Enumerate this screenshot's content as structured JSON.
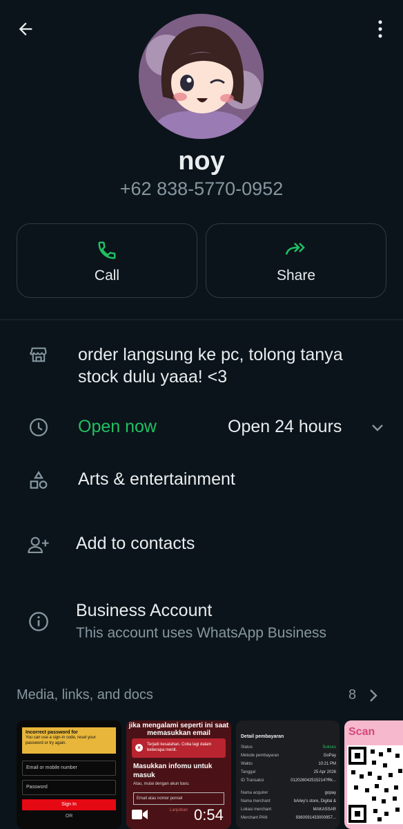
{
  "header": {
    "back_icon": "arrow-back-icon",
    "menu_icon": "more-vertical-icon"
  },
  "profile": {
    "name": "noy",
    "phone": "+62 838-5770-0952"
  },
  "actions": [
    {
      "label": "Call",
      "icon": "phone-icon"
    },
    {
      "label": "Share",
      "icon": "forward-icon"
    }
  ],
  "business": {
    "description": "order langsung ke pc, tolong tanya stock dulu yaaa! <3",
    "open_status": "Open now",
    "hours": "Open 24 hours",
    "category": "Arts & entertainment"
  },
  "add_contacts": "Add to contacts",
  "business_account": {
    "title": "Business Account",
    "subtitle": "This account uses WhatsApp Business"
  },
  "media": {
    "title": "Media, links, and docs",
    "count": "8",
    "thumb1": {
      "heading": "Incorrect password for",
      "body": "You can use a sign-in code, reset your password or try again.",
      "field1": "Email or mobile number",
      "field2": "Password",
      "button": "Sign In",
      "or": "OR"
    },
    "thumb2": {
      "top": "jika mengalami seperti ini saat memasukkan email",
      "error": "Terjadi kesalahan. Coba lagi dalam beberapa menit.",
      "heading": "Masukkan infomu untuk masuk",
      "sub": "Atau, mulai dengan akun baru.",
      "input": "Email atau nomor ponsel",
      "button": "Lanjutkan",
      "duration": "0:54"
    },
    "thumb3": {
      "heading": "Detail pembayaran",
      "rows": [
        {
          "k": "Status",
          "v": "Sukses"
        },
        {
          "k": "Metode pembayaran",
          "v": "GoPay"
        },
        {
          "k": "Waktu",
          "v": "10:21 PM"
        },
        {
          "k": "Tanggal",
          "v": "25 Apr 2026"
        },
        {
          "k": "ID Transaksi",
          "v": "012026042515214?Rk..."
        },
        {
          "k": "Nama acquirer",
          "v": "gopay"
        },
        {
          "k": "Nama merchant",
          "v": "bAiley's store, Digital &"
        },
        {
          "k": "Lokasi merchant",
          "v": "MAKASSAR"
        },
        {
          "k": "Merchant PAN",
          "v": "9360091433000957..."
        }
      ]
    },
    "thumb4": {
      "label": "Scan"
    }
  },
  "colors": {
    "background": "#0b141a",
    "accent_green": "#21c063",
    "muted": "#8696a0"
  }
}
